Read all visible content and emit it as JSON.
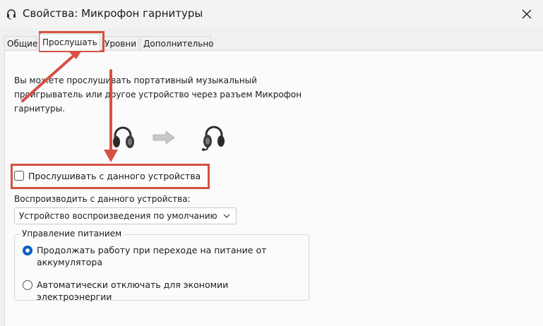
{
  "window": {
    "title": "Свойства: Микрофон гарнитуры",
    "icon": "headset-icon",
    "close_icon": "close-icon"
  },
  "tabs": [
    {
      "label": "Общие",
      "active": false
    },
    {
      "label": "Прослушать",
      "active": true
    },
    {
      "label": "Уровни",
      "active": false
    },
    {
      "label": "Дополнительно",
      "active": false
    }
  ],
  "listen": {
    "description": "Вы можете прослушивать портативный музыкальный проигрыватель или другое устройство через разъем Микрофон гарнитуры.",
    "checkbox_label": "Прослушивать с данного устройства",
    "checkbox_checked": false,
    "playback_label": "Воспроизводить с данного устройства:",
    "playback_device": "Устройство воспроизведения по умолчанию"
  },
  "power": {
    "group_label": "Управление питанием",
    "options": [
      {
        "label": "Продолжать работу при переходе на питание от аккумулятора",
        "selected": true
      },
      {
        "label": "Автоматически отключать для экономии электроэнергии",
        "selected": false
      }
    ]
  },
  "colors": {
    "accent": "#0a5fc4",
    "annotation": "#d65143"
  }
}
